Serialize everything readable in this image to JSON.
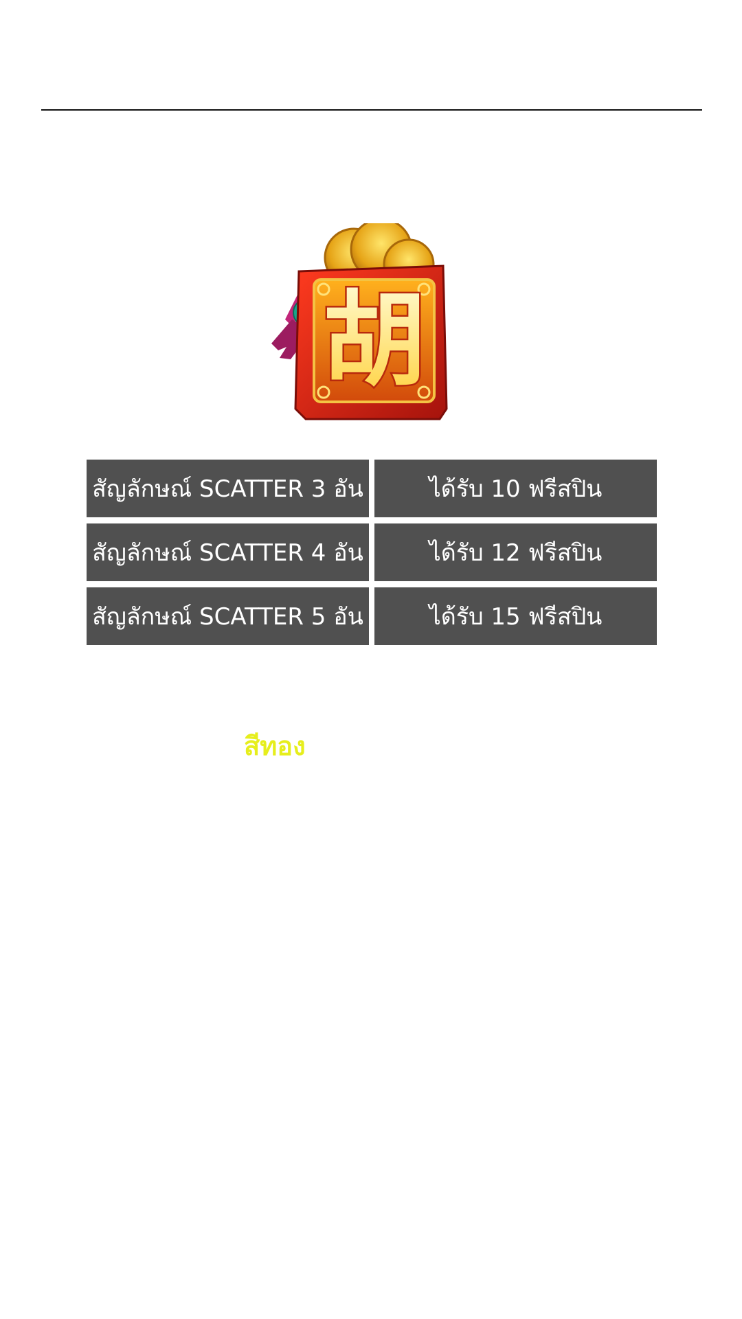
{
  "symbol": {
    "glyph": "胡",
    "icon": "red-envelope-scatter-icon"
  },
  "payouts": [
    {
      "condition": "สัญลักษณ์ SCATTER 3 อัน",
      "reward": "ได้รับ 10 ฟรีสปิน"
    },
    {
      "condition": "สัญลักษณ์ SCATTER 4 อัน",
      "reward": "ได้รับ 12 ฟรีสปิน"
    },
    {
      "condition": "สัญลักษณ์ SCATTER 5 อัน",
      "reward": "ได้รับ 15 ฟรีสปิน"
    }
  ],
  "gold_label": {
    "text": "สีทอง",
    "color": "#e6ee1c"
  },
  "colors": {
    "cell_bg": "#505050",
    "cell_text": "#ffffff",
    "divider": "#111111"
  }
}
